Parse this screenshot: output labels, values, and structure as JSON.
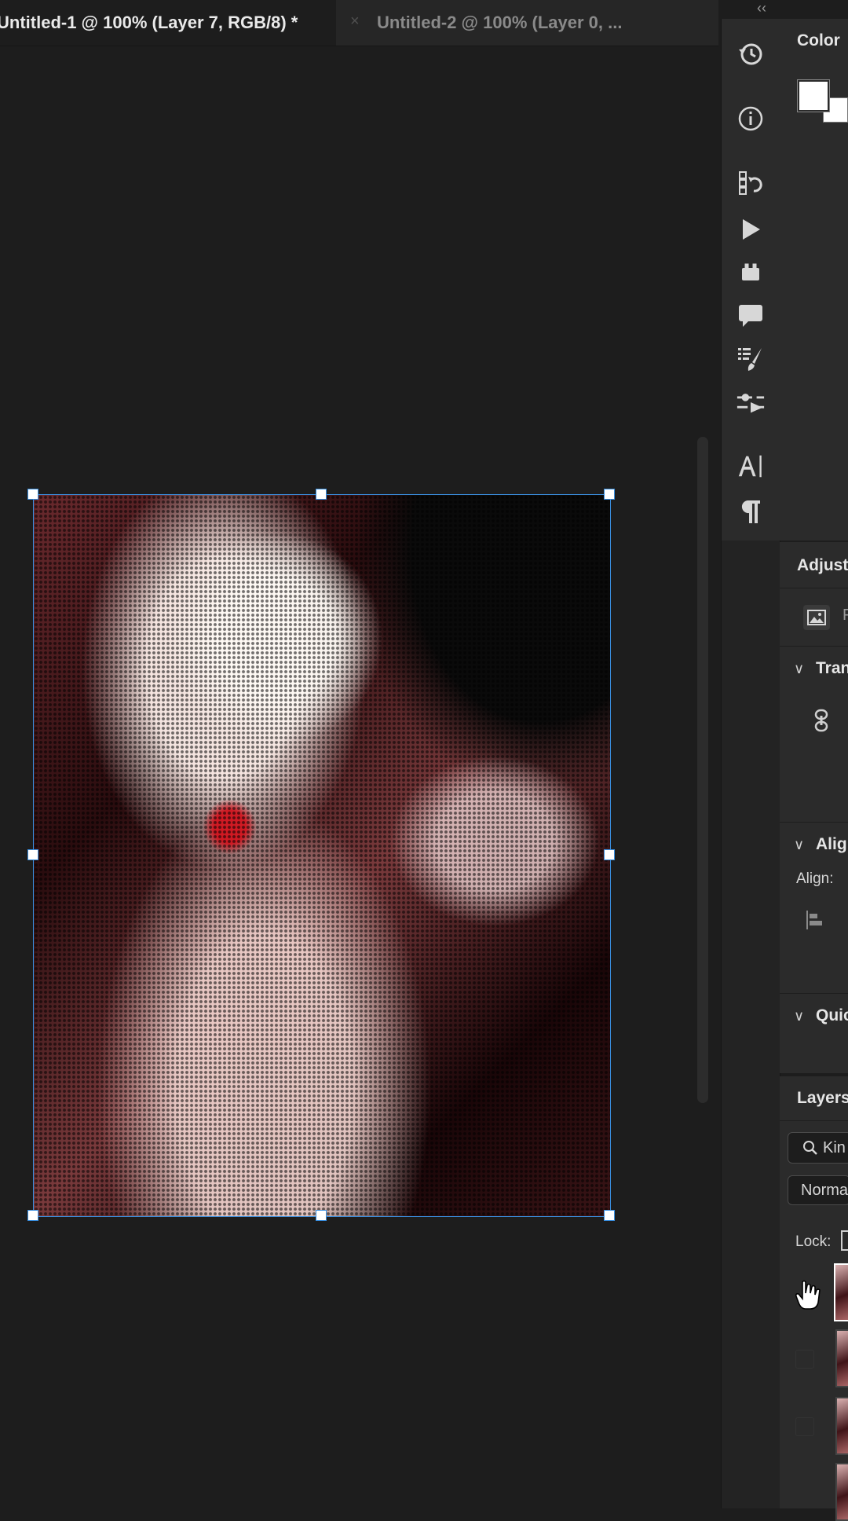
{
  "tabs": [
    {
      "label": "Untitled-1 @ 100% (Layer 7, RGB/8) *"
    },
    {
      "label": "Untitled-2 @ 100% (Layer 0, ..."
    }
  ],
  "icons": {
    "tab_close": "×",
    "collapse": "‹‹",
    "toolstrip": [
      "history-icon",
      "info-icon",
      "brush-settings-icon",
      "play-actions-icon",
      "lock-icon",
      "comment-icon",
      "brush-presets-icon",
      "properties-sliders-icon",
      "character-icon",
      "paragraph-icon"
    ]
  },
  "right_panel": {
    "color_title": "Color",
    "adjustments_title": "Adjust",
    "transform_label": "Tran",
    "align_label": "Alig",
    "align_field_label": "Align:",
    "quick_label": "Quic",
    "layers_title": "Layers",
    "search_text": "Kin",
    "blend_mode": "Norma",
    "lock_label": "Lock:",
    "adjust_partial": "F"
  },
  "colors": {
    "selection": "#3a8fe0",
    "panel_bg": "#2b2b2b",
    "canvas_bg": "#1d1d1d"
  }
}
